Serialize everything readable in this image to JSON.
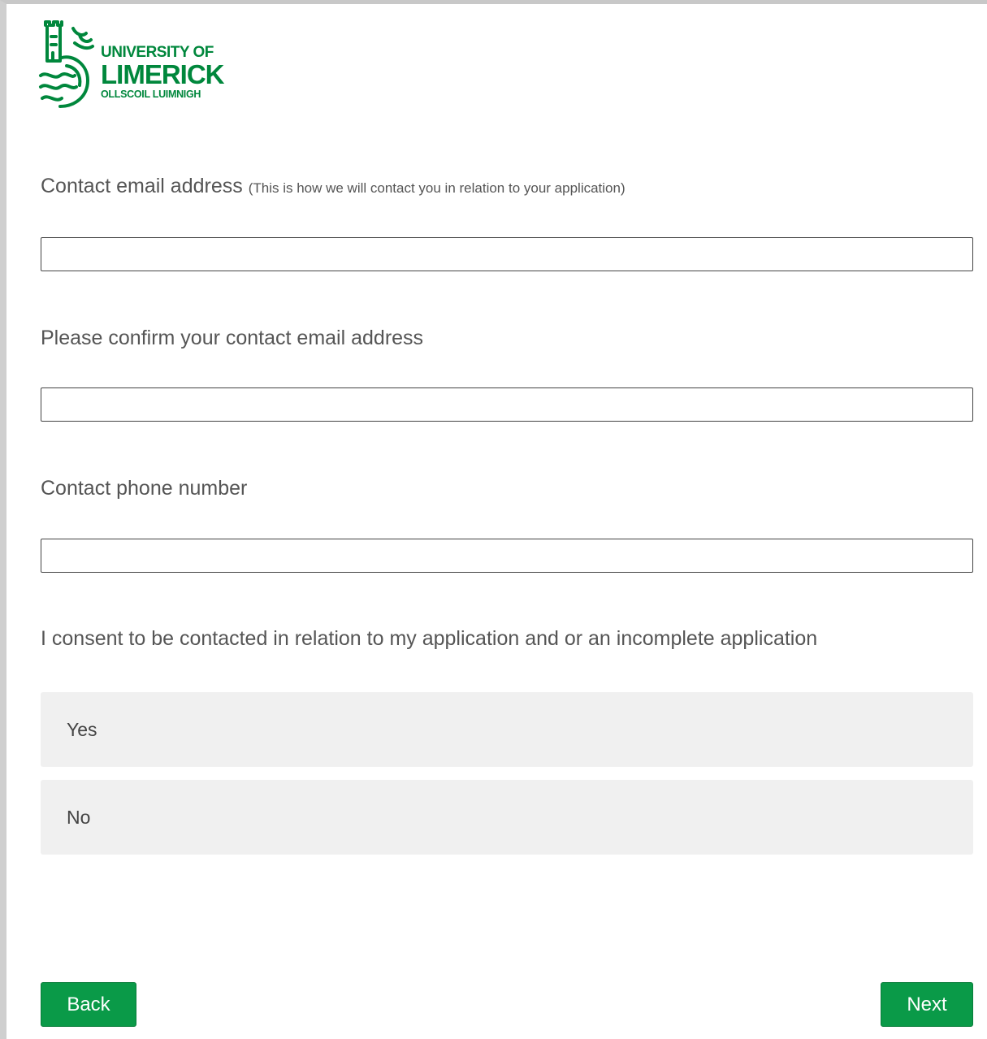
{
  "logo": {
    "line1": "UNIVERSITY OF",
    "line2": "LIMERICK",
    "line3": "OLLSCOIL LUIMNIGH",
    "brand_color": "#00873c",
    "icon": "university-crest-icon"
  },
  "form": {
    "email": {
      "label": "Contact email address",
      "hint": "(This is how we will contact you in relation to your application)",
      "value": ""
    },
    "confirm_email": {
      "label": "Please confirm your contact email address",
      "value": ""
    },
    "phone": {
      "label": "Contact phone number",
      "value": ""
    },
    "consent": {
      "question": "I consent to be contacted in relation to my application and or an incomplete application",
      "options": [
        {
          "label": "Yes"
        },
        {
          "label": "No"
        }
      ]
    }
  },
  "nav": {
    "back_label": "Back",
    "next_label": "Next",
    "button_color": "#0a9a48"
  }
}
